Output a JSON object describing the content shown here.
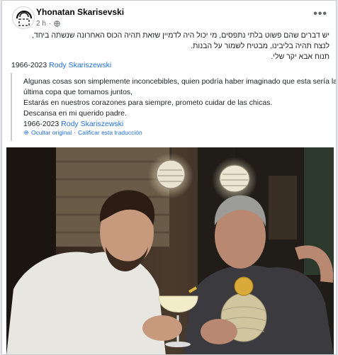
{
  "post": {
    "author": "Yhonatan Skarisevski",
    "time": "2 h",
    "separator": "·",
    "more_label": "•••",
    "hebrew_lines": [
      "יש דברים שהם פשוט בלתי נתפסים, מי יכול היה לדמיין שזאת תהיה הכוס האחרונה שנשתה ביחד,",
      "לנצח תהיה בליבינו, מבטיח לשמור על הבנות.",
      "תנוח אבא יקר שלי."
    ],
    "signature_years": "1966-2023",
    "signature_name": "Rody Skariszewski"
  },
  "translation": {
    "lines": [
      "Algunas cosas son simplemente inconcebibles, quien podría haber imaginado que esta sería la",
      "última copa que tomamos juntos,",
      "Estarás en nuestros corazones para siempre, prometo cuidar de las chicas.",
      "Descansa en mi querido padre."
    ],
    "signature_years": "1966-2023",
    "signature_name": "Rody Skariszewski",
    "hide_original": "Ocultar original",
    "dot": "·",
    "rate_translation": "Calificar esta traducción"
  },
  "colors": {
    "link": "#216fdb",
    "secondary_text": "#65676b"
  },
  "icons": {
    "avatar": "profile-logo-icon",
    "privacy": "globe-icon",
    "translation": "gear-icon"
  }
}
